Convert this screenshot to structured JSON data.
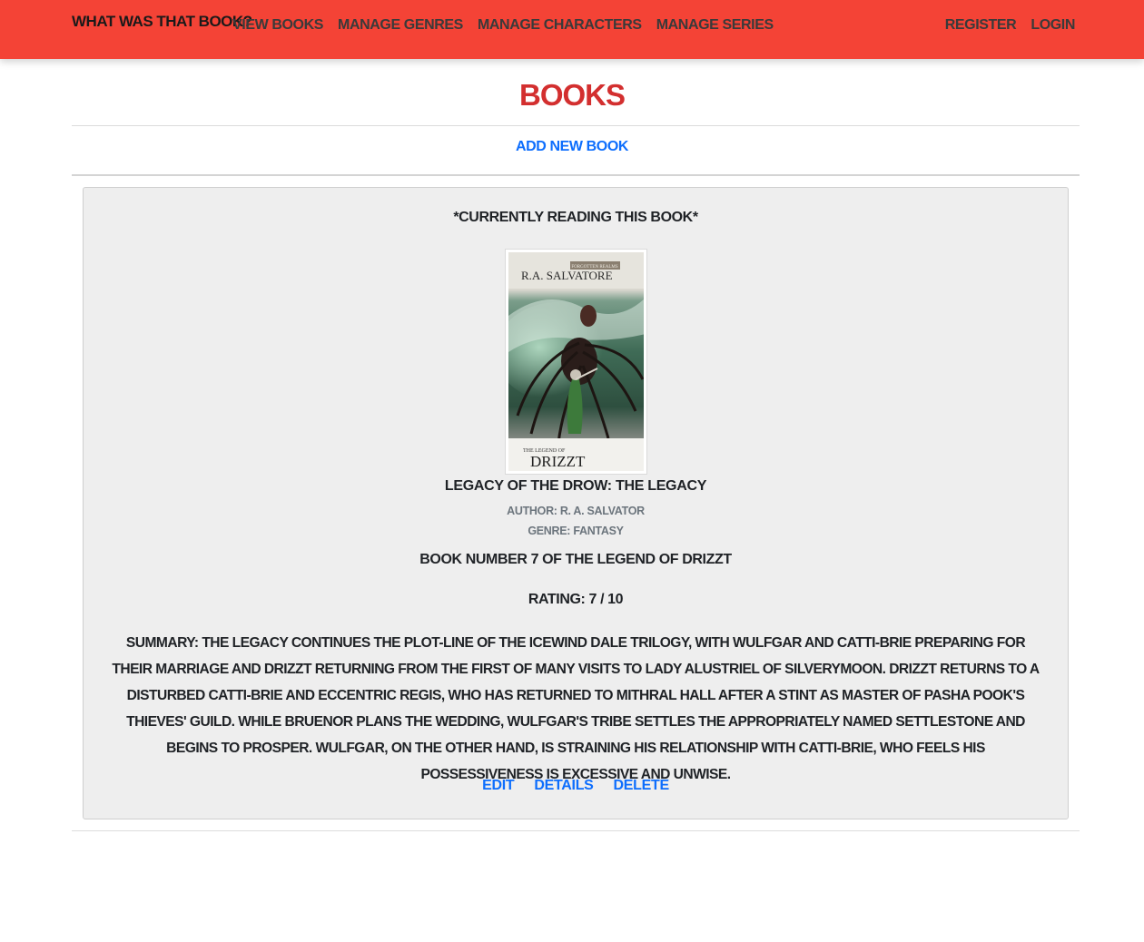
{
  "navbar": {
    "brand": "What was that book?",
    "links": [
      "View Books",
      "Manage Genres",
      "Manage Characters",
      "Manage Series"
    ],
    "right_links": [
      "Register",
      "Login"
    ],
    "color": "#f44336"
  },
  "page": {
    "title": "Books",
    "add_label": "Add New Book"
  },
  "book": {
    "reading_label": "*Currently Reading this book*",
    "cover_author_text": "R.A. SALVATORE",
    "cover_badge_text": "FORGOTTEN REALMS",
    "cover_series_small": "THE LEGEND OF",
    "cover_series_big": "DRIZZT",
    "title": "Legacy of the Drow: The Legacy",
    "author": "Author: R. A. Salvator",
    "genre": "Genre: Fantasy",
    "series": "Book number 7 of The Legend of Drizzt",
    "rating": "Rating: 7 / 10",
    "summary": "Summary: The Legacy continues the plot-line of The Icewind Dale Trilogy, with Wulfgar and Catti-brie preparing for their marriage and Drizzt returning from the first of many visits to Lady Alustriel of Silverymoon. Drizzt returns to a disturbed Catti-brie and eccentric Regis, who has returned to Mithral Hall after a stint as Master of Pasha Pook's Thieves' Guild. While Bruenor plans the wedding, Wulfgar's tribe settles the appropriately named Settlestone and begins to prosper. Wulfgar, on the other hand, is straining his relationship with Catti-brie, who feels his possessiveness is excessive and unwise.",
    "actions": [
      "Edit",
      "Details",
      "Delete"
    ]
  },
  "colors": {
    "accent": "#f44336",
    "title": "#d32f2f",
    "link": "#0d6efd",
    "card_bg": "#eeeeee"
  }
}
